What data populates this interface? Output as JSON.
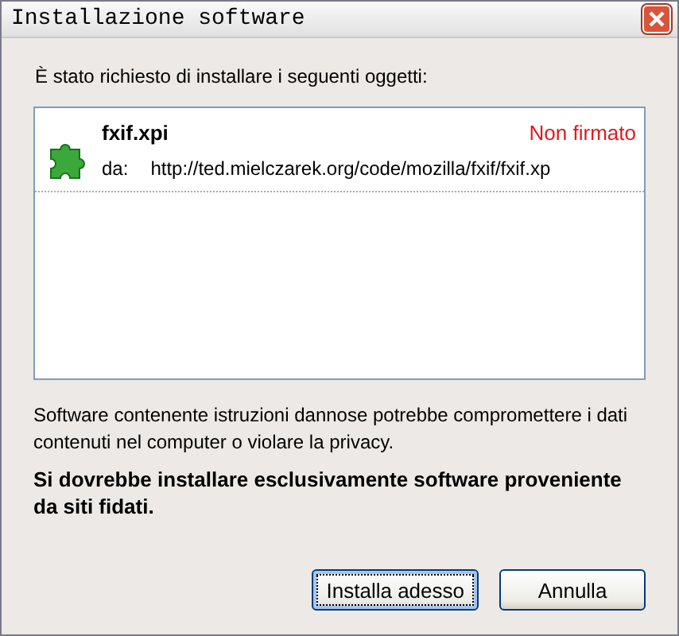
{
  "window": {
    "title": "Installazione software"
  },
  "intro": "È stato richiesto di installare i seguenti oggetti:",
  "items": [
    {
      "name": "fxif.xpi",
      "status": "Non firmato",
      "from_label": "da:",
      "url": "http://ted.mielczarek.org/code/mozilla/fxif/fxif.xp"
    }
  ],
  "warning": "Software contenente istruzioni dannose potrebbe compromettere i dati contenuti nel computer o violare la privacy.",
  "advice": "Si dovrebbe installare esclusivamente software proveniente da siti fidati.",
  "buttons": [
    {
      "label": "Installa adesso",
      "focused": true
    },
    {
      "label": "Annulla",
      "focused": false
    }
  ]
}
